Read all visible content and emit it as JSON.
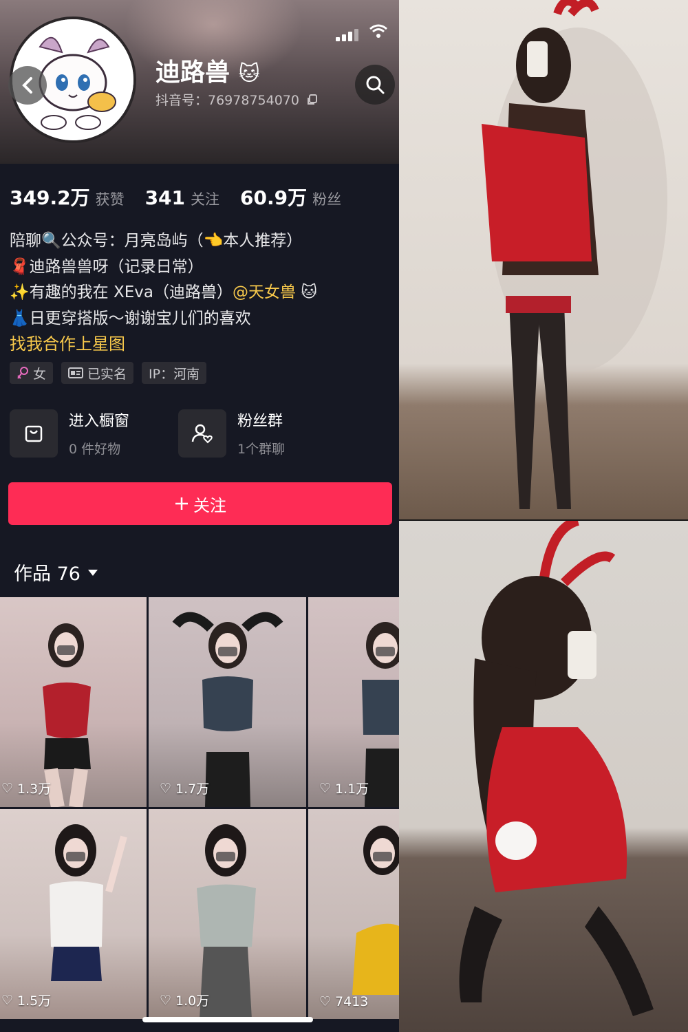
{
  "profile": {
    "username": "迪路兽",
    "douyin_id": "抖音号：76978754070"
  },
  "stats": [
    {
      "value": "349.2万",
      "label": "获赞"
    },
    {
      "value": "341",
      "label": "关注"
    },
    {
      "value": "60.9万",
      "label": "粉丝"
    }
  ],
  "bio": {
    "line1": "陪聊🔍公众号：月亮岛屿（👈本人推荐）",
    "line2": "🧣迪路兽兽呀（记录日常）",
    "line3_prefix": "✨有趣的我在 XEva（迪路兽）",
    "line3_mention": "@天女兽",
    "line3_emoji": "🐱",
    "line4": "👗日更穿搭版～谢谢宝儿们的喜欢",
    "link": "找我合作上星图"
  },
  "tags": [
    {
      "icon": "female-icon",
      "label": "女"
    },
    {
      "icon": "id-card-icon",
      "label": "已实名"
    },
    {
      "icon": "",
      "label": "IP：河南"
    }
  ],
  "shortcuts": [
    {
      "icon": "shop-bag-icon",
      "title": "进入橱窗",
      "sub": "0 件好物"
    },
    {
      "icon": "fan-group-icon",
      "title": "粉丝群",
      "sub": "1个群聊"
    }
  ],
  "follow_button": "关注",
  "works_tab": "作品 76",
  "videos": [
    {
      "likes": "1.3万"
    },
    {
      "likes": "1.7万"
    },
    {
      "likes": "1.1万"
    },
    {
      "likes": "1.5万"
    },
    {
      "likes": "1.0万"
    },
    {
      "likes": "7413"
    }
  ],
  "colors": {
    "follow_button": "#fe2c55",
    "mention": "#f7c84b",
    "background": "#161823"
  }
}
